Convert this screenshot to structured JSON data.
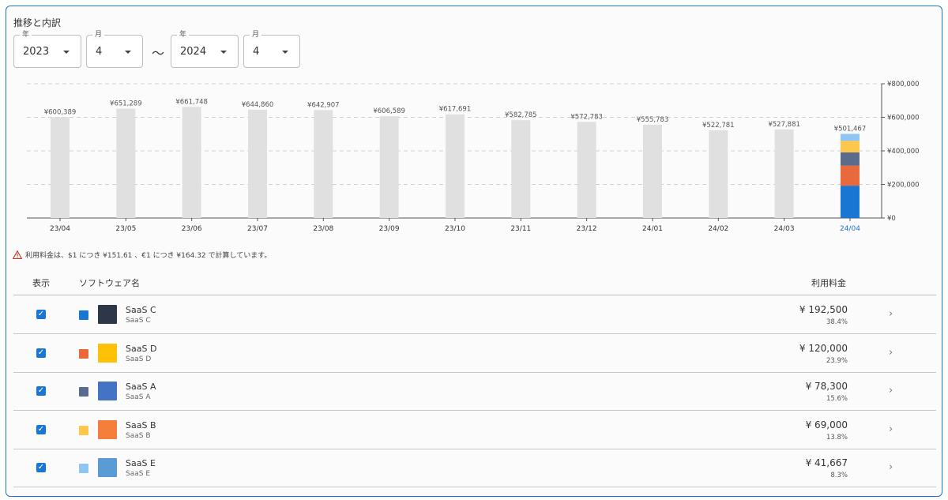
{
  "section": {
    "title": "推移と内訳"
  },
  "filters": {
    "start_year": {
      "label": "年",
      "value": "2023"
    },
    "start_month": {
      "label": "月",
      "value": "4"
    },
    "separator": "～",
    "end_year": {
      "label": "年",
      "value": "2024"
    },
    "end_month": {
      "label": "月",
      "value": "4"
    }
  },
  "chart_data": {
    "type": "bar",
    "categories": [
      "23/04",
      "23/05",
      "23/06",
      "23/07",
      "23/08",
      "23/09",
      "23/10",
      "23/11",
      "23/12",
      "24/01",
      "24/02",
      "24/03",
      "24/04"
    ],
    "values": [
      600389,
      651289,
      661748,
      644860,
      642907,
      606589,
      617691,
      582785,
      572783,
      555783,
      522781,
      527881,
      501467
    ],
    "data_labels": [
      "¥600,389",
      "¥651,289",
      "¥661,748",
      "¥644,860",
      "¥642,907",
      "¥606,589",
      "¥617,691",
      "¥582,785",
      "¥572,783",
      "¥555,783",
      "¥522,781",
      "¥527,881",
      "¥501,467"
    ],
    "selected_category": "24/04",
    "selected_breakdown": [
      {
        "name": "SaaS C",
        "value": 192500,
        "color": "#1976d2"
      },
      {
        "name": "SaaS D",
        "value": 120000,
        "color": "#e8693c"
      },
      {
        "name": "SaaS A",
        "value": 78300,
        "color": "#5b6b8c"
      },
      {
        "name": "SaaS B",
        "value": 69000,
        "color": "#fcc74b"
      },
      {
        "name": "SaaS E",
        "value": 41667,
        "color": "#90c4f2"
      }
    ],
    "y_ticks": [
      0,
      200000,
      400000,
      600000,
      800000
    ],
    "y_tick_labels": [
      "¥0",
      "¥200,000",
      "¥400,000",
      "¥600,000",
      "¥800,000"
    ],
    "ylim": [
      0,
      800000
    ],
    "y_axis_position": "right",
    "grid": true,
    "bar_color": "#e0e0e0",
    "selected_label_color": "#1976d2"
  },
  "note": {
    "text": "利用料金は、$1 につき ¥151.61 、€1 につき ¥164.32 で計算しています。",
    "icon": "warning-icon"
  },
  "table": {
    "headers": {
      "show": "表示",
      "software": "ソフトウェア名",
      "fee": "利用料金"
    },
    "rows": [
      {
        "name": "SaaS C",
        "sub": "SaaS C",
        "price": "¥ 192,500",
        "pct": "38.4%",
        "swatch": "#1976d2",
        "logo": "#2d3748"
      },
      {
        "name": "SaaS D",
        "sub": "SaaS D",
        "price": "¥ 120,000",
        "pct": "23.9%",
        "swatch": "#e8693c",
        "logo": "#ffc107"
      },
      {
        "name": "SaaS A",
        "sub": "SaaS A",
        "price": "¥ 78,300",
        "pct": "15.6%",
        "swatch": "#5b6b8c",
        "logo": "#4472c4"
      },
      {
        "name": "SaaS B",
        "sub": "SaaS B",
        "price": "¥ 69,000",
        "pct": "13.8%",
        "swatch": "#fcc74b",
        "logo": "#f37f3a"
      },
      {
        "name": "SaaS E",
        "sub": "SaaS E",
        "price": "¥ 41,667",
        "pct": "8.3%",
        "swatch": "#90c4f2",
        "logo": "#5b9bd5"
      }
    ]
  }
}
